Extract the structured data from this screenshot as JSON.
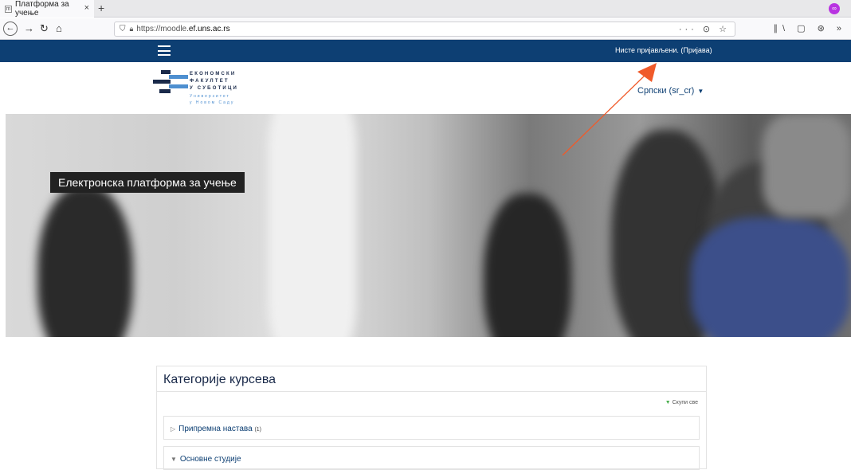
{
  "browser": {
    "tab_title": "Платформа за учење",
    "tab_close": "×",
    "new_tab": "+",
    "url_prefix": "https://moodle.",
    "url_domain": "ef.uns.ac.rs",
    "url_actions": "··· ⊙ ☆",
    "toolbar_icons": "∥\\ ▢ ⊛ »",
    "profile_badge": "∞"
  },
  "site": {
    "login_note": "Нисте пријављени. (Пријава)",
    "language": "Српски (sr_cr)",
    "colors": {
      "nav": "#0d3f73",
      "arrow": "#f05a2a",
      "logo_dark": "#1a2a4a",
      "logo_blue": "#4e8fd0"
    }
  },
  "logo": {
    "line1": "ЕКОНОМСКИ",
    "line2": "ФАКУЛТЕТ",
    "line3": "У СУБОТИЦИ",
    "sub1": "Универзитет",
    "sub2": "у Новом Саду"
  },
  "hero": {
    "title": "Електронска платформа за учење"
  },
  "categories": {
    "heading": "Категорије курсева",
    "collapse_all": "Скупи све",
    "items": [
      {
        "label": "Припремна настава",
        "count": "(1)",
        "state": "collapsed"
      },
      {
        "label": "Основне студије",
        "count": "",
        "state": "expanded"
      }
    ]
  }
}
